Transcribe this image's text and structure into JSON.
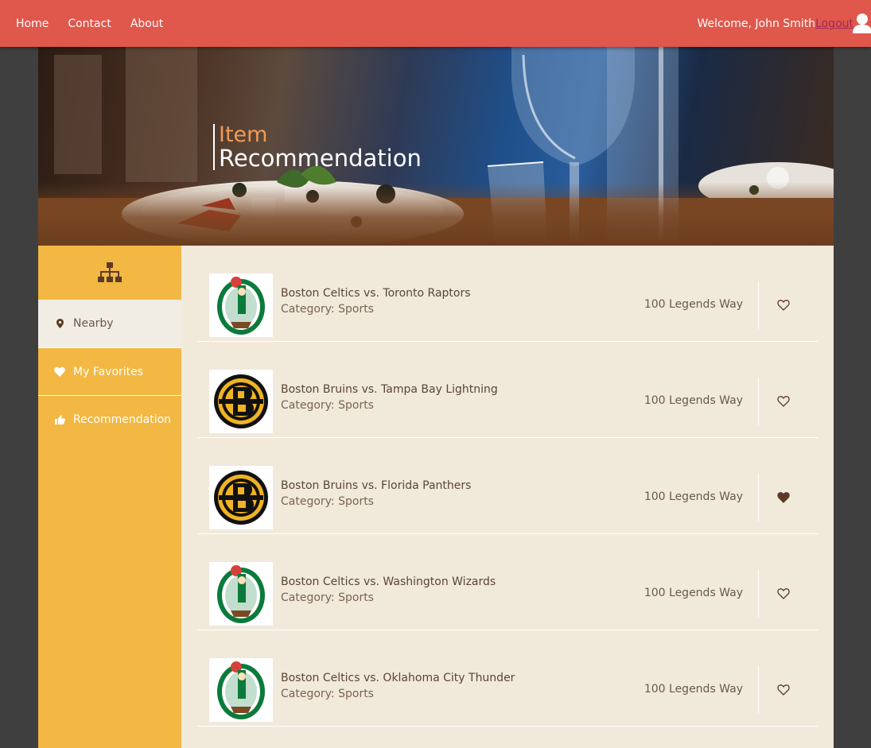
{
  "nav": {
    "links": [
      "Home",
      "Contact",
      "About"
    ],
    "welcome": "Welcome, John Smith",
    "logout": "Logout"
  },
  "hero": {
    "line1": "Item",
    "line2": "Recommendation"
  },
  "sidebar": {
    "top_icon": "sitemap-icon",
    "items": [
      {
        "label": "Nearby",
        "icon": "map-pin-icon",
        "active": true
      },
      {
        "label": "My Favorites",
        "icon": "heart-icon",
        "active": false
      },
      {
        "label": "Recommendation",
        "icon": "thumbs-up-icon",
        "active": false
      }
    ]
  },
  "items": [
    {
      "name": "Boston Celtics vs. Toronto Raptors",
      "category": "Category: Sports",
      "address": "100 Legends Way",
      "logo": "celtics-logo",
      "favorite": false
    },
    {
      "name": "Boston Bruins vs. Tampa Bay Lightning",
      "category": "Category: Sports",
      "address": "100 Legends Way",
      "logo": "bruins-logo",
      "favorite": false
    },
    {
      "name": "Boston Bruins vs. Florida Panthers",
      "category": "Category: Sports",
      "address": "100 Legends Way",
      "logo": "bruins-logo",
      "favorite": true
    },
    {
      "name": "Boston Celtics vs. Washington Wizards",
      "category": "Category: Sports",
      "address": "100 Legends Way",
      "logo": "celtics-logo",
      "favorite": false
    },
    {
      "name": "Boston Celtics vs. Oklahoma City Thunder",
      "category": "Category: Sports",
      "address": "100 Legends Way",
      "logo": "celtics-logo",
      "favorite": false
    }
  ],
  "colors": {
    "topbar": "#e0574b",
    "sidebar": "#f2b843",
    "main_bg": "#f1e9da",
    "heart": "#5a3a28"
  }
}
